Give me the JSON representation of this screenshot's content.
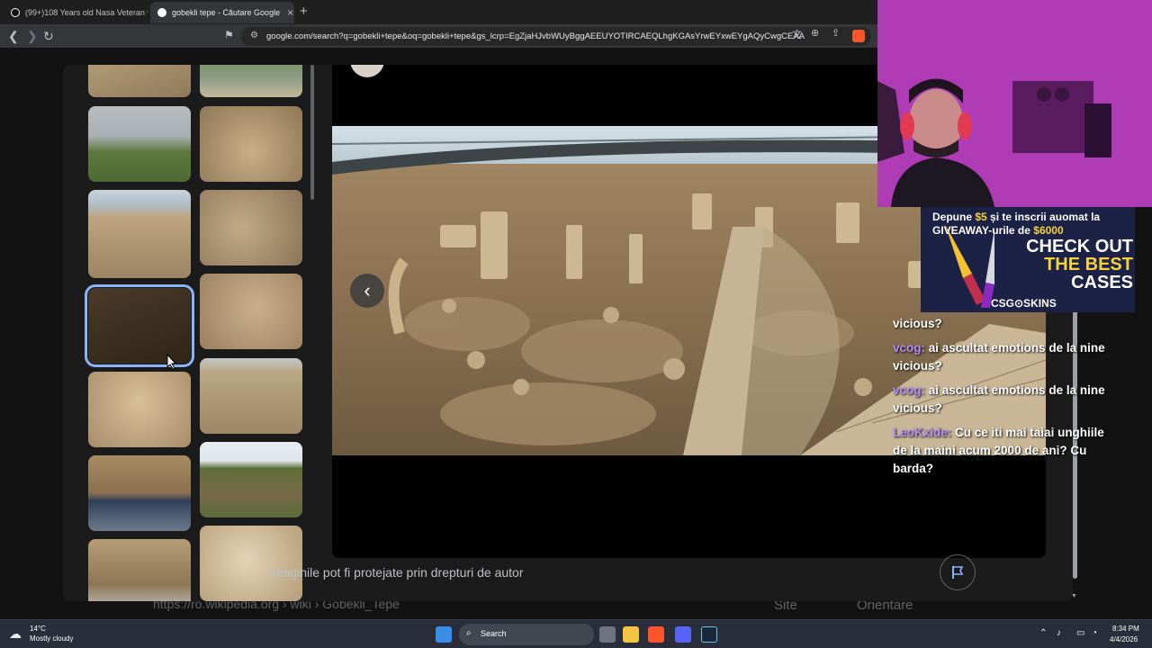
{
  "browser": {
    "tabs": [
      {
        "title": "(99+)108 Years old Nasa Veteran wa",
        "active": false
      },
      {
        "title": "gobekli tepe - Căutare Google",
        "active": true
      }
    ],
    "new_tab": "+",
    "url": "google.com/search?q=gobekli+tepe&oq=gobekli+tepe&gs_lcrp=EgZjaHJvbWUyBggAEEUYOTIRCAEQLhgKGAsYrwEYxwEYgAQyCwgCEAA"
  },
  "background_results": {
    "link": "https://ro.wikipedia.org › wiki › Gobekli_Tepe",
    "site_chip": "Site",
    "orient_chip": "Orientare"
  },
  "viewer": {
    "prev_label": "‹",
    "copyright": "Imaginile pot fi protejate prin drepturi de autor"
  },
  "ad": {
    "line1_pre": "Depune ",
    "line1_amount": "$5",
    "line1_post": " și te inscrii auomat la",
    "line2_pre": "GIVEAWAY-urile de ",
    "line2_amount": "$6000",
    "cta_line1": "CHECK OUT",
    "cta_line2": "THE BEST",
    "cta_line3": "CASES",
    "brand": "CSG⊙SKINS"
  },
  "chat": [
    {
      "user": "",
      "text": "vicious?"
    },
    {
      "user": "vcog:",
      "text": "ai ascultat emotions de la nine vicious?"
    },
    {
      "user": "vcog:",
      "text": "ai ascultat emotions de la nine vicious?"
    },
    {
      "user": "LeoKxide:",
      "text": "Cu ce iti mai taiai unghiile de la maini acum 2000 de ani? Cu barda?"
    }
  ],
  "taskbar": {
    "weather_temp": "14°C",
    "weather_desc": "Mostly cloudy",
    "search": "Search",
    "time": "8:34 PM",
    "date": "4/4/2026"
  },
  "colors": {
    "accent": "#8ab4f8",
    "chat_user": "#b68cf7",
    "ad_highlight": "#f5d13b"
  }
}
